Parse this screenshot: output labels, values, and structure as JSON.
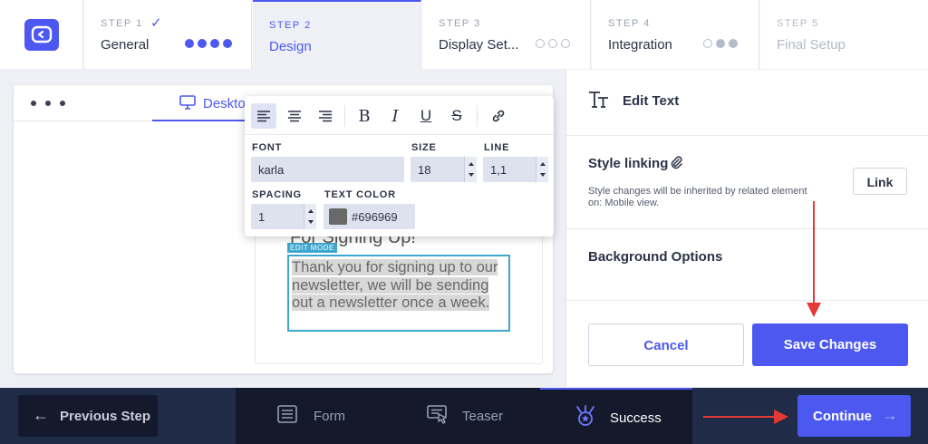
{
  "steps": [
    {
      "number": "STEP 1",
      "check": "✓",
      "label": "General",
      "state": "done"
    },
    {
      "number": "STEP 2",
      "label": "Design",
      "state": "active"
    },
    {
      "number": "STEP 3",
      "label": "Display Set...",
      "state": "todo"
    },
    {
      "number": "STEP 4",
      "label": "Integration",
      "state": "todo"
    },
    {
      "number": "STEP 5",
      "label": "Final Setup",
      "state": "disabled"
    }
  ],
  "editor": {
    "device_tab": "Deskto",
    "heading": "For Signing Up!",
    "edit_badge": "EDIT MODE",
    "body_text": "Thank you for signing up to our newsletter, we will be sending out a newsletter once a week."
  },
  "toolbar": {
    "font_label": "FONT",
    "font_value": "karla",
    "size_label": "SIZE",
    "size_value": "18",
    "line_label": "LINE",
    "line_value": "1,1",
    "spacing_label": "SPACING",
    "spacing_value": "1",
    "color_label": "TEXT COLOR",
    "color_value": "#696969"
  },
  "right_panel": {
    "title": "Edit Text",
    "style_linking": "Style linking",
    "style_desc": "Style changes will be inherited by related element on: Mobile view.",
    "link_button": "Link",
    "background_options": "Background Options",
    "cancel_button": "Cancel",
    "save_button": "Save Changes"
  },
  "bottom": {
    "previous": "Previous Step",
    "tabs": [
      "Form",
      "Teaser",
      "Success"
    ],
    "continue": "Continue"
  },
  "colors": {
    "accent": "#4d58f0",
    "dark_bar": "#1f2b47",
    "edit_highlight": "#3ea7cf",
    "annotation_arrow": "#e53935"
  }
}
